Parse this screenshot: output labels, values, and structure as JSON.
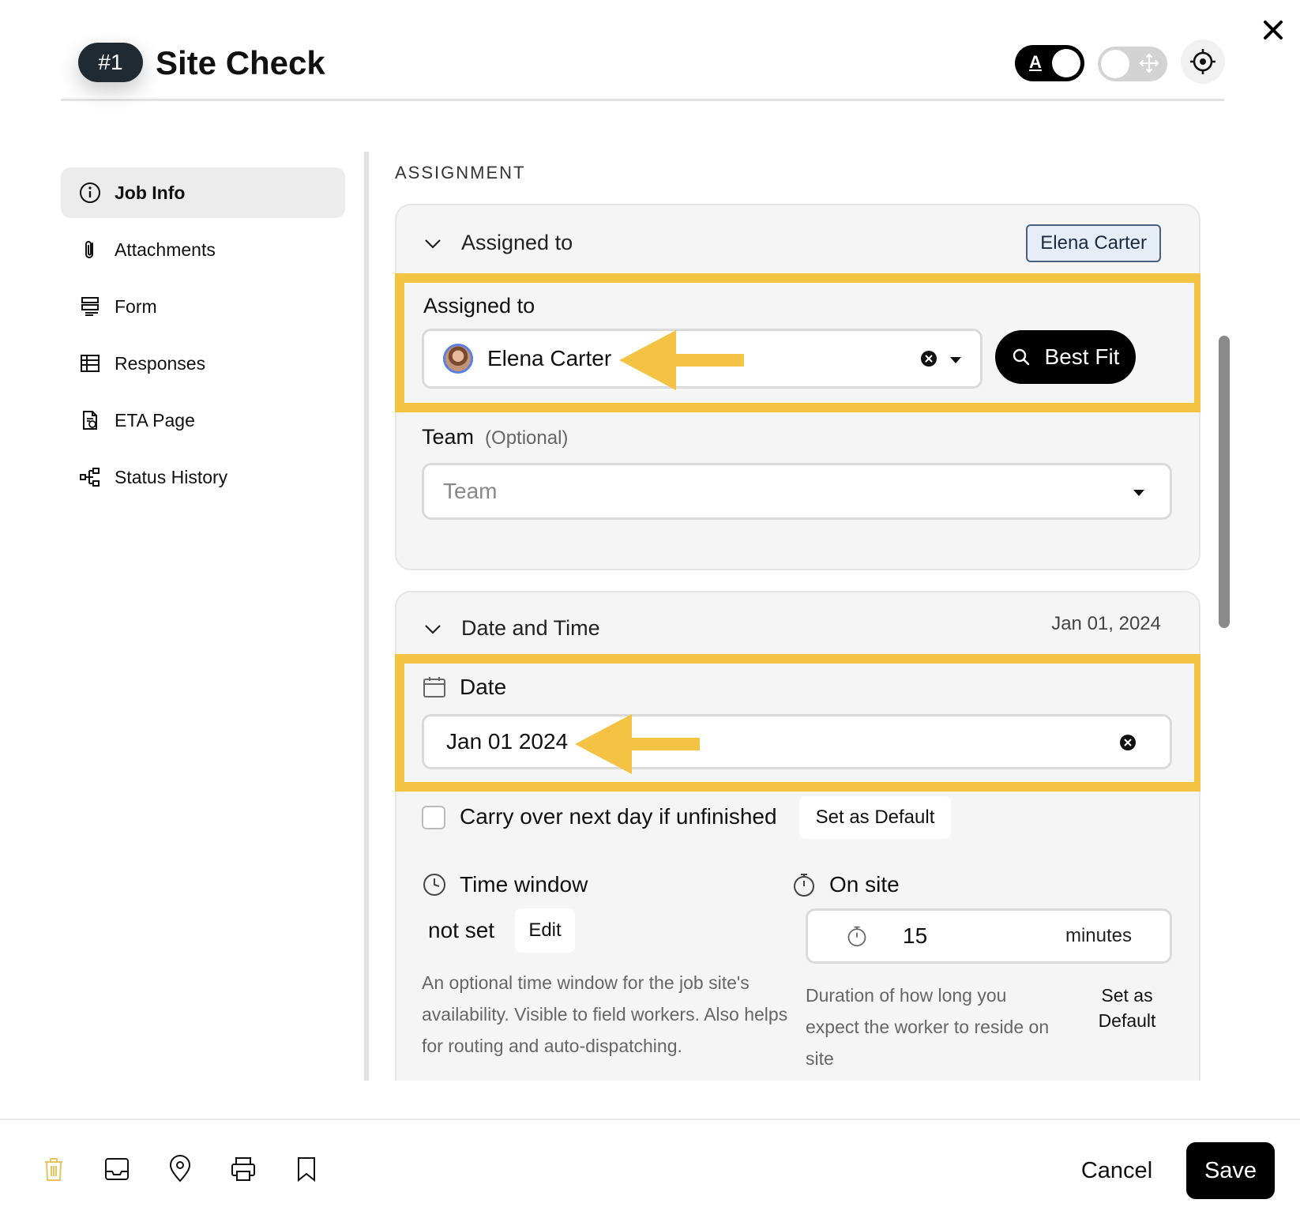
{
  "header": {
    "job_number": "#1",
    "title": "Site Check",
    "toggle_text_glyph": "A"
  },
  "sidebar": {
    "items": [
      {
        "label": "Job Info",
        "icon": "info-icon",
        "active": true
      },
      {
        "label": "Attachments",
        "icon": "paperclip-icon"
      },
      {
        "label": "Form",
        "icon": "form-icon"
      },
      {
        "label": "Responses",
        "icon": "table-icon"
      },
      {
        "label": "ETA Page",
        "icon": "document-icon"
      },
      {
        "label": "Status History",
        "icon": "hierarchy-icon"
      }
    ]
  },
  "assignment": {
    "section_label": "ASSIGNMENT",
    "assigned_card": {
      "heading": "Assigned to",
      "summary": "Elena Carter",
      "field_label": "Assigned to",
      "assignee": "Elena Carter",
      "best_fit_label": "Best Fit",
      "team_label": "Team",
      "team_optional": "(Optional)",
      "team_placeholder": "Team"
    },
    "date_card": {
      "heading": "Date and Time",
      "summary": "Jan 01, 2024",
      "date_label": "Date",
      "date_value": "Jan 01 2024",
      "carry_over_label": "Carry over next day if unfinished",
      "set_default_label": "Set as Default",
      "time_window": {
        "label": "Time window",
        "value": "not set",
        "edit_label": "Edit",
        "description": "An optional time window for the job site's availability. Visible to field workers. Also helps for routing and auto-dispatching."
      },
      "on_site": {
        "label": "On site",
        "value": "15",
        "unit": "minutes",
        "description": "Duration of how long you expect the worker to reside on site",
        "set_default_label": "Set as Default"
      }
    }
  },
  "footer": {
    "cancel_label": "Cancel",
    "save_label": "Save"
  },
  "colors": {
    "highlight": "#f5c344",
    "primary_button": "#000000",
    "badge": "#1f2a33",
    "trash_icon": "#e8c25a"
  }
}
